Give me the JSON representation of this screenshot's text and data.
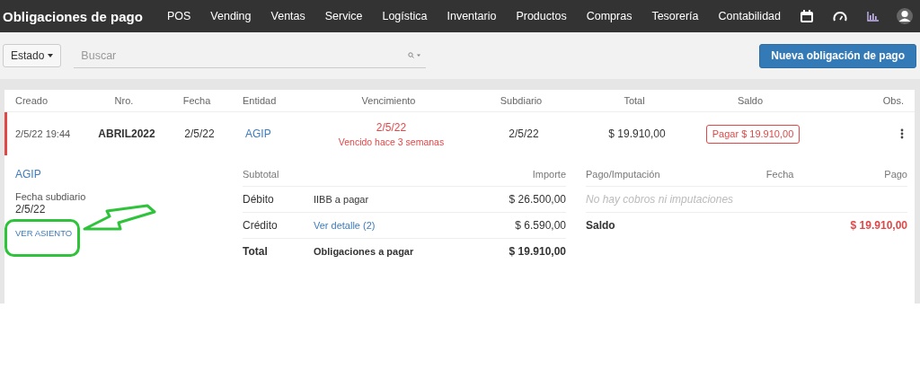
{
  "app_bar": {
    "title": "Obligaciones de pago",
    "nav": [
      "POS",
      "Vending",
      "Ventas",
      "Service",
      "Logística",
      "Inventario",
      "Productos",
      "Compras",
      "Tesorería",
      "Contabilidad"
    ]
  },
  "toolbar": {
    "status_button": "Estado",
    "search": {
      "placeholder": "Buscar"
    },
    "new_button": "Nueva obligación de pago"
  },
  "table": {
    "columns": [
      "Creado",
      "Nro.",
      "Fecha",
      "Entidad",
      "Vencimiento",
      "Subdiario",
      "Total",
      "Saldo",
      "Obs."
    ],
    "rows": [
      {
        "created": "2/5/22 19:44",
        "number": "ABRIL2022",
        "date": "2/5/22",
        "entity": "AGIP",
        "due_date": "2/5/22",
        "due_note": "Vencido hace 3 semanas",
        "overdue": true,
        "subdiario": "2/5/22",
        "total": "$ 19.910,00",
        "pay_button": "Pagar $ 19.910,00"
      }
    ]
  },
  "detail": {
    "entity": "AGIP",
    "subdiario_label": "Fecha subdiario",
    "subdiario_date": "2/5/22",
    "entry_link": "VER ASIENTO",
    "lines": {
      "columns": [
        "Subtotal",
        "Importe"
      ],
      "rows": [
        {
          "kind": "text",
          "label": "Débito",
          "description": "IIBB a pagar",
          "amount": "$ 26.500,00"
        },
        {
          "kind": "link",
          "label": "Crédito",
          "description": "Ver detalle (2)",
          "amount": "$ 6.590,00"
        },
        {
          "kind": "total",
          "label": "Total",
          "description": "Obligaciones a pagar",
          "amount": "$ 19.910,00"
        }
      ]
    },
    "payments": {
      "columns": [
        "Pago/Imputación",
        "Fecha",
        "Pago"
      ],
      "empty": "No hay cobros ni imputaciones",
      "balance_label": "Saldo",
      "balance": "$ 19.910,00"
    }
  }
}
